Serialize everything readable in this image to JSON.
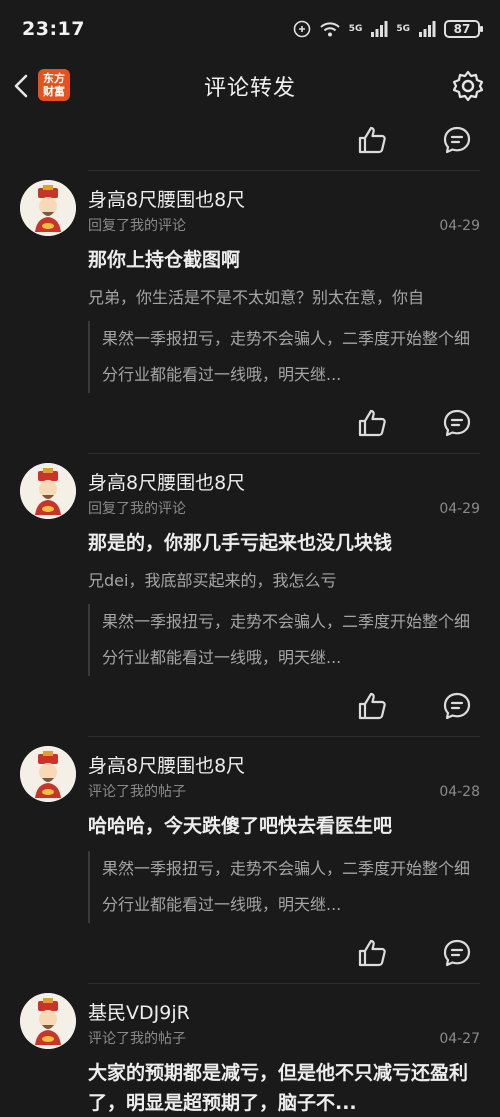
{
  "status": {
    "time": "23:17",
    "battery": "87",
    "net1": "5G",
    "net2": "5G"
  },
  "nav": {
    "title": "评论转发",
    "logo_line1": "东方",
    "logo_line2": "财富"
  },
  "items": [
    {
      "user": "身高8尺腰围也8尺",
      "action": "回复了我的评论",
      "date": "04-29",
      "text": "那你上持仓截图啊",
      "sub": "兄弟，你生活是不是不太如意？别太在意，你自",
      "quote": "果然一季报扭亏，走势不会骗人，二季度开始整个细分行业都能看过一线哦，明天继..."
    },
    {
      "user": "身高8尺腰围也8尺",
      "action": "回复了我的评论",
      "date": "04-29",
      "text": "那是的，你那几手亏起来也没几块钱",
      "sub": "兄dei，我底部买起来的，我怎么亏",
      "quote": "果然一季报扭亏，走势不会骗人，二季度开始整个细分行业都能看过一线哦，明天继..."
    },
    {
      "user": "身高8尺腰围也8尺",
      "action": "评论了我的帖子",
      "date": "04-28",
      "text": "哈哈哈，今天跌傻了吧快去看医生吧",
      "quote": "果然一季报扭亏，走势不会骗人，二季度开始整个细分行业都能看过一线哦，明天继..."
    },
    {
      "user": "基民VDJ9jR",
      "action": "评论了我的帖子",
      "date": "04-27",
      "text": "大家的预期都是减亏，但是他不只减亏还盈利了，明显是超预期了，脑子不..."
    }
  ]
}
